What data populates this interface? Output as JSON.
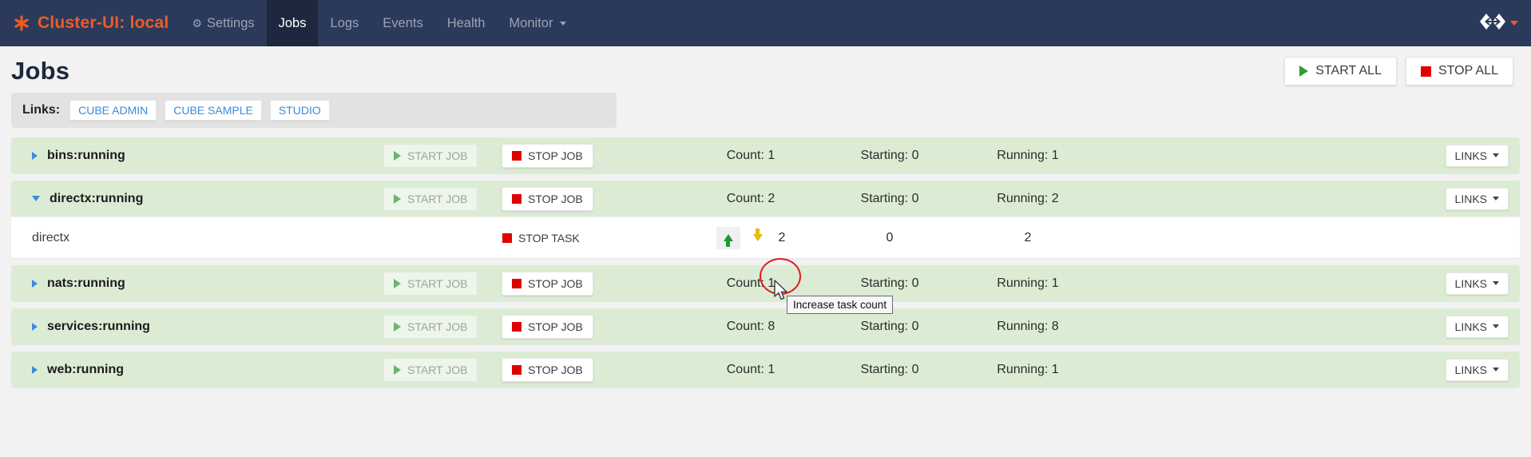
{
  "navbar": {
    "brand": "Cluster-UI: local",
    "brand_icon": "asterisk-logo-icon",
    "brand_color": "#ef5b25",
    "background": "#2b3a5b",
    "items": [
      {
        "label": "Settings",
        "icon": "gear-icon",
        "active": false,
        "caret": false
      },
      {
        "label": "Jobs",
        "icon": "",
        "active": true,
        "caret": false
      },
      {
        "label": "Logs",
        "icon": "",
        "active": false,
        "caret": false
      },
      {
        "label": "Events",
        "icon": "",
        "active": false,
        "caret": false
      },
      {
        "label": "Health",
        "icon": "",
        "active": false,
        "caret": false
      },
      {
        "label": "Monitor",
        "icon": "",
        "active": false,
        "caret": true
      }
    ],
    "right_icon": "exchange-arrows-icon"
  },
  "header": {
    "title": "Jobs",
    "start_all_label": "START ALL",
    "stop_all_label": "STOP ALL",
    "start_icon": "play-triangle-icon",
    "stop_icon": "stop-square-icon"
  },
  "links_bar": {
    "label": "Links:",
    "buttons": [
      "CUBE ADMIN",
      "CUBE SAMPLE",
      "STUDIO"
    ]
  },
  "table": {
    "start_job_label": "START JOB",
    "stop_job_label": "STOP JOB",
    "stop_task_label": "STOP TASK",
    "links_label": "LINKS",
    "count_prefix": "Count: ",
    "starting_prefix": "Starting: ",
    "running_prefix": "Running: "
  },
  "jobs": [
    {
      "name": "bins:running",
      "expanded": false,
      "count": "Count: 1",
      "starting": "Starting: 0",
      "running": "Running: 1",
      "tasks": []
    },
    {
      "name": "directx:running",
      "expanded": true,
      "count": "Count: 2",
      "starting": "Starting: 0",
      "running": "Running: 2",
      "tasks": [
        {
          "name": "directx",
          "stop_label": "STOP TASK",
          "count": "2",
          "starting": "0",
          "running": "2",
          "increase_icon": "arrow-up-icon",
          "decrease_icon": "arrow-down-icon"
        }
      ]
    },
    {
      "name": "nats:running",
      "expanded": false,
      "count": "Count: 1",
      "starting": "Starting: 0",
      "running": "Running: 1",
      "tasks": []
    },
    {
      "name": "services:running",
      "expanded": false,
      "count": "Count: 8",
      "starting": "Starting: 0",
      "running": "Running: 8",
      "tasks": []
    },
    {
      "name": "web:running",
      "expanded": false,
      "count": "Count: 1",
      "starting": "Starting: 0",
      "running": "Running: 1",
      "tasks": []
    }
  ],
  "tooltip": {
    "text": "Increase task count"
  },
  "annotation": {
    "shape": "red-ellipse-highlight",
    "color": "#e01b1b"
  }
}
